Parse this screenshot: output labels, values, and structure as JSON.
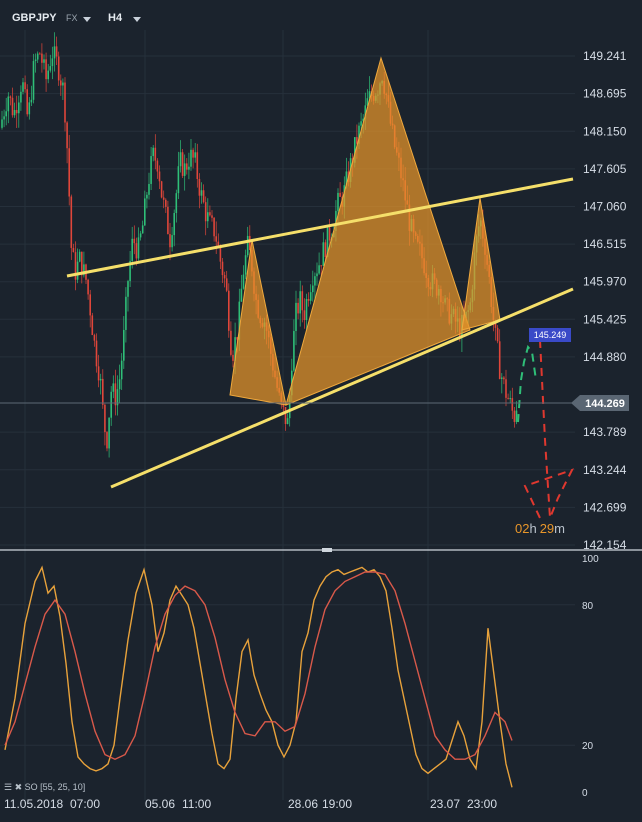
{
  "header": {
    "symbol": "GBPJPY",
    "instrument_type": "FX",
    "interval": "H4"
  },
  "chart_data": [
    {
      "type": "candlestick",
      "title": "GBPJPY",
      "y_tick_labels": [
        "149.241",
        "148.695",
        "148.150",
        "147.605",
        "147.060",
        "146.515",
        "145.970",
        "145.425",
        "144.880",
        "143.789",
        "143.244",
        "142.699",
        "142.154"
      ],
      "ylim": [
        142.154,
        149.6
      ],
      "current_price": "144.269",
      "marker_price": "145.249",
      "countdown": {
        "hours": "02",
        "h_unit": "h",
        "minutes": "29",
        "m_unit": "m"
      },
      "x_tick_labels": [
        "11.05.2018",
        "07:00",
        "05.06",
        "11:00",
        "28.06",
        "19:00",
        "23.07",
        "23:00"
      ],
      "candle_trend": [
        [
          0,
          148.2
        ],
        [
          8,
          148.7
        ],
        [
          14,
          148.4
        ],
        [
          22,
          148.9
        ],
        [
          28,
          148.3
        ],
        [
          34,
          149.1
        ],
        [
          40,
          149.3
        ],
        [
          46,
          148.9
        ],
        [
          52,
          149.3
        ],
        [
          58,
          149.1
        ],
        [
          64,
          148.7
        ],
        [
          68,
          147.7
        ],
        [
          71,
          146.5
        ],
        [
          75,
          146.1
        ],
        [
          80,
          146.3
        ],
        [
          86,
          146.0
        ],
        [
          90,
          145.6
        ],
        [
          95,
          145.0
        ],
        [
          100,
          144.6
        ],
        [
          104,
          143.9
        ],
        [
          107,
          143.7
        ],
        [
          111,
          144.4
        ],
        [
          116,
          144.3
        ],
        [
          120,
          144.6
        ],
        [
          124,
          145.2
        ],
        [
          128,
          146.0
        ],
        [
          133,
          146.6
        ],
        [
          138,
          146.4
        ],
        [
          143,
          146.8
        ],
        [
          148,
          147.4
        ],
        [
          153,
          147.8
        ],
        [
          158,
          147.7
        ],
        [
          162,
          147.2
        ],
        [
          166,
          146.9
        ],
        [
          170,
          146.6
        ],
        [
          175,
          147.1
        ],
        [
          180,
          147.7
        ],
        [
          185,
          147.6
        ],
        [
          190,
          147.8
        ],
        [
          195,
          147.7
        ],
        [
          200,
          147.3
        ],
        [
          205,
          147.0
        ],
        [
          210,
          146.8
        ],
        [
          215,
          146.7
        ],
        [
          220,
          146.3
        ],
        [
          226,
          145.9
        ],
        [
          232,
          144.9
        ],
        [
          238,
          145.3
        ],
        [
          243,
          146.1
        ],
        [
          248,
          146.5
        ],
        [
          252,
          146.2
        ],
        [
          256,
          145.7
        ],
        [
          260,
          145.5
        ],
        [
          265,
          145.4
        ],
        [
          270,
          145.0
        ],
        [
          275,
          144.6
        ],
        [
          280,
          144.2
        ],
        [
          285,
          144.0
        ],
        [
          288,
          143.9
        ],
        [
          292,
          144.9
        ],
        [
          296,
          145.5
        ],
        [
          300,
          145.7
        ],
        [
          304,
          145.5
        ],
        [
          308,
          145.8
        ],
        [
          313,
          146.1
        ],
        [
          318,
          146.2
        ],
        [
          323,
          146.4
        ],
        [
          328,
          146.6
        ],
        [
          333,
          146.8
        ],
        [
          338,
          147.1
        ],
        [
          343,
          147.2
        ],
        [
          348,
          147.5
        ],
        [
          353,
          147.8
        ],
        [
          358,
          148.1
        ],
        [
          363,
          148.3
        ],
        [
          368,
          148.6
        ],
        [
          373,
          148.7
        ],
        [
          378,
          148.8
        ],
        [
          382,
          149.0
        ],
        [
          386,
          148.7
        ],
        [
          390,
          148.3
        ],
        [
          395,
          147.9
        ],
        [
          400,
          147.6
        ],
        [
          405,
          147.2
        ],
        [
          410,
          146.8
        ],
        [
          415,
          146.5
        ],
        [
          420,
          146.4
        ],
        [
          425,
          146.2
        ],
        [
          430,
          146.0
        ],
        [
          435,
          145.9
        ],
        [
          440,
          145.9
        ],
        [
          445,
          145.6
        ],
        [
          450,
          145.5
        ],
        [
          455,
          145.4
        ],
        [
          460,
          145.3
        ],
        [
          465,
          145.4
        ],
        [
          470,
          145.6
        ],
        [
          475,
          146.4
        ],
        [
          480,
          146.9
        ],
        [
          485,
          146.5
        ],
        [
          490,
          145.9
        ],
        [
          495,
          145.2
        ],
        [
          500,
          144.7
        ],
        [
          505,
          144.4
        ],
        [
          510,
          144.2
        ],
        [
          514,
          144.0
        ],
        [
          518,
          144.3
        ]
      ]
    },
    {
      "type": "line",
      "title": "SO [55, 25, 10]",
      "y_tick_labels": [
        "100",
        "80",
        "20",
        "0"
      ],
      "ylim": [
        0,
        100
      ],
      "series": [
        {
          "color": "#e8a23b",
          "x": [
            5,
            15,
            25,
            35,
            42,
            48,
            54,
            60,
            66,
            72,
            78,
            84,
            90,
            96,
            102,
            108,
            114,
            120,
            128,
            136,
            144,
            152,
            158,
            164,
            170,
            176,
            182,
            188,
            194,
            200,
            206,
            212,
            218,
            224,
            230,
            236,
            242,
            248,
            254,
            260,
            266,
            272,
            278,
            284,
            290,
            296,
            302,
            308,
            314,
            320,
            326,
            332,
            338,
            344,
            350,
            356,
            362,
            368,
            374,
            380,
            386,
            392,
            398,
            404,
            410,
            416,
            422,
            428,
            434,
            440,
            446,
            452,
            458,
            464,
            470,
            476,
            482,
            488,
            494,
            500,
            506,
            512
          ],
          "y": [
            18,
            40,
            72,
            90,
            96,
            85,
            88,
            75,
            55,
            30,
            15,
            12,
            10,
            9,
            10,
            12,
            20,
            40,
            65,
            85,
            95,
            80,
            60,
            68,
            82,
            88,
            84,
            80,
            70,
            55,
            40,
            25,
            12,
            10,
            14,
            40,
            60,
            65,
            50,
            42,
            35,
            30,
            20,
            15,
            20,
            30,
            60,
            68,
            82,
            88,
            92,
            94,
            95,
            93,
            94,
            95,
            96,
            94,
            95,
            92,
            86,
            70,
            52,
            40,
            28,
            16,
            10,
            8,
            10,
            12,
            14,
            22,
            30,
            24,
            14,
            10,
            30,
            70,
            50,
            30,
            12,
            2
          ]
        },
        {
          "color": "#d9594a",
          "x": [
            5,
            15,
            25,
            35,
            45,
            55,
            65,
            75,
            85,
            95,
            105,
            115,
            125,
            135,
            145,
            155,
            165,
            175,
            185,
            195,
            205,
            215,
            225,
            235,
            245,
            255,
            265,
            275,
            285,
            295,
            305,
            315,
            325,
            335,
            345,
            355,
            365,
            375,
            385,
            395,
            405,
            415,
            425,
            435,
            445,
            455,
            465,
            475,
            485,
            495,
            505,
            512
          ],
          "y": [
            20,
            30,
            46,
            62,
            76,
            82,
            76,
            60,
            42,
            26,
            16,
            14,
            16,
            24,
            42,
            62,
            76,
            84,
            88,
            86,
            80,
            66,
            48,
            34,
            25,
            24,
            30,
            30,
            26,
            28,
            42,
            62,
            78,
            86,
            90,
            92,
            94,
            94,
            93,
            86,
            72,
            56,
            40,
            24,
            18,
            14,
            14,
            16,
            24,
            34,
            30,
            22
          ]
        }
      ]
    }
  ]
}
